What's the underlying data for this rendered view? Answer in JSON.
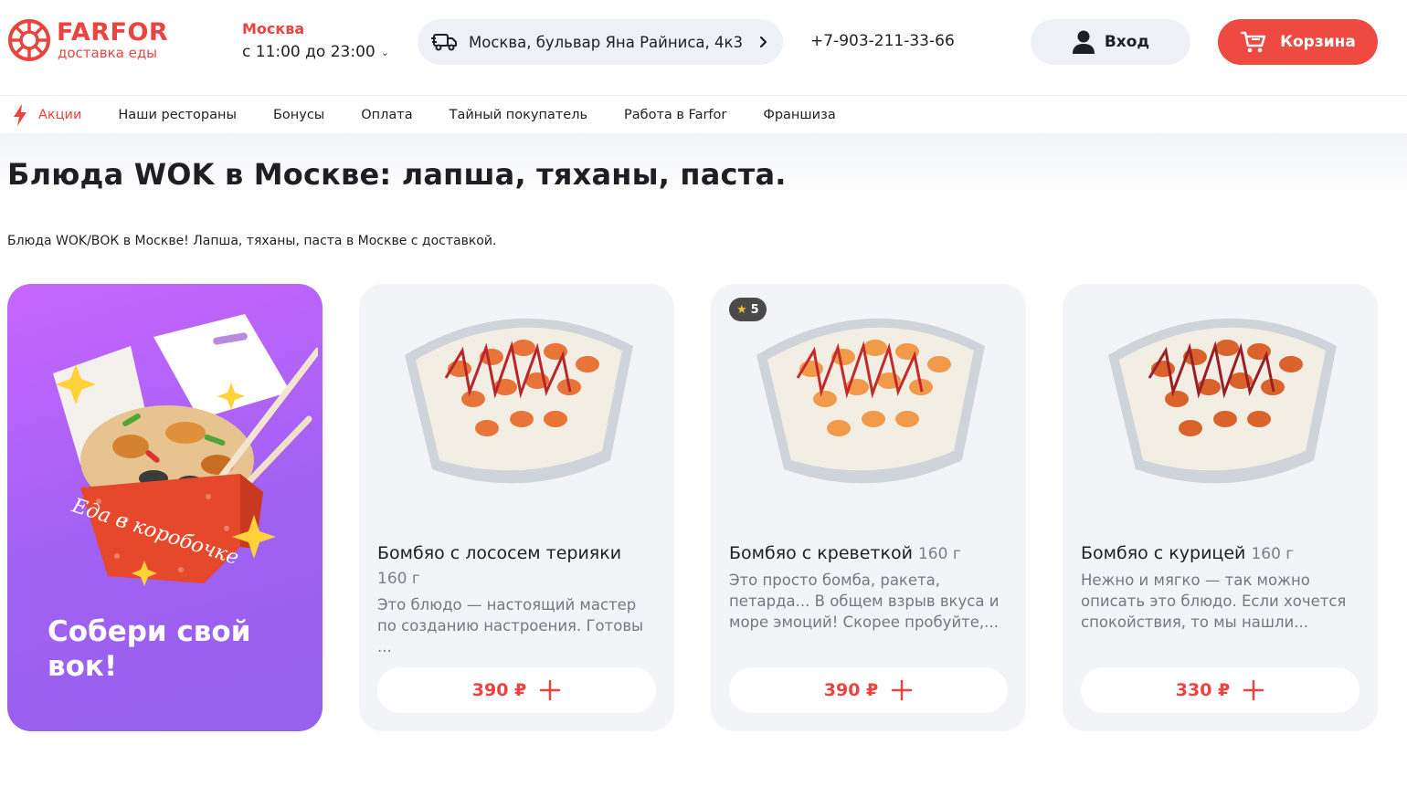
{
  "brand": {
    "name": "FARFOR",
    "tagline": "доставка еды",
    "color": "#e9443f"
  },
  "location": {
    "city": "Москва",
    "hours": "с 11:00 до 23:00"
  },
  "address": "Москва, бульвар Яна Райниса, 4к3",
  "phone": "+7-903-211-33-66",
  "login": {
    "label": "Вход",
    "icon": "user-icon"
  },
  "cart": {
    "label": "Корзина",
    "icon": "cart-icon",
    "color": "#ee4a42"
  },
  "nav": [
    {
      "label": "Акции",
      "icon": "lightning-icon"
    },
    {
      "label": "Наши рестораны"
    },
    {
      "label": "Бонусы"
    },
    {
      "label": "Оплата"
    },
    {
      "label": "Тайный покупатель"
    },
    {
      "label": "Работа в Farfor"
    },
    {
      "label": "Франшиза"
    }
  ],
  "page": {
    "title": "Блюда WOK в Москве: лапша, тяханы, паста.",
    "description": "Блюда WOK/ВОК в Москве! Лапша, тяханы, паста в Москве с доставкой."
  },
  "promo": {
    "title": "Собери свой вок!",
    "box_text": "Еда в коробочке"
  },
  "products": [
    {
      "name": "Бомбяо с лососем терияки",
      "weight": "160 г",
      "description": "Это блюдо — настоящий мастер по созданию настроения. Готовы ...",
      "price": "390 ₽",
      "rating": null
    },
    {
      "name": "Бомбяо с креветкой",
      "weight": "160 г",
      "description": "Это просто бомба, ракета, петарда... В общем взрыв вкуса и море эмоций! Скорее пробуйте,...",
      "price": "390 ₽",
      "rating": "5"
    },
    {
      "name": "Бомбяо с курицей",
      "weight": "160 г",
      "description": "Нежно и мягко — так можно описать это блюдо. Если хочется спокойствия, то мы нашли...",
      "price": "330 ₽",
      "rating": null
    }
  ]
}
